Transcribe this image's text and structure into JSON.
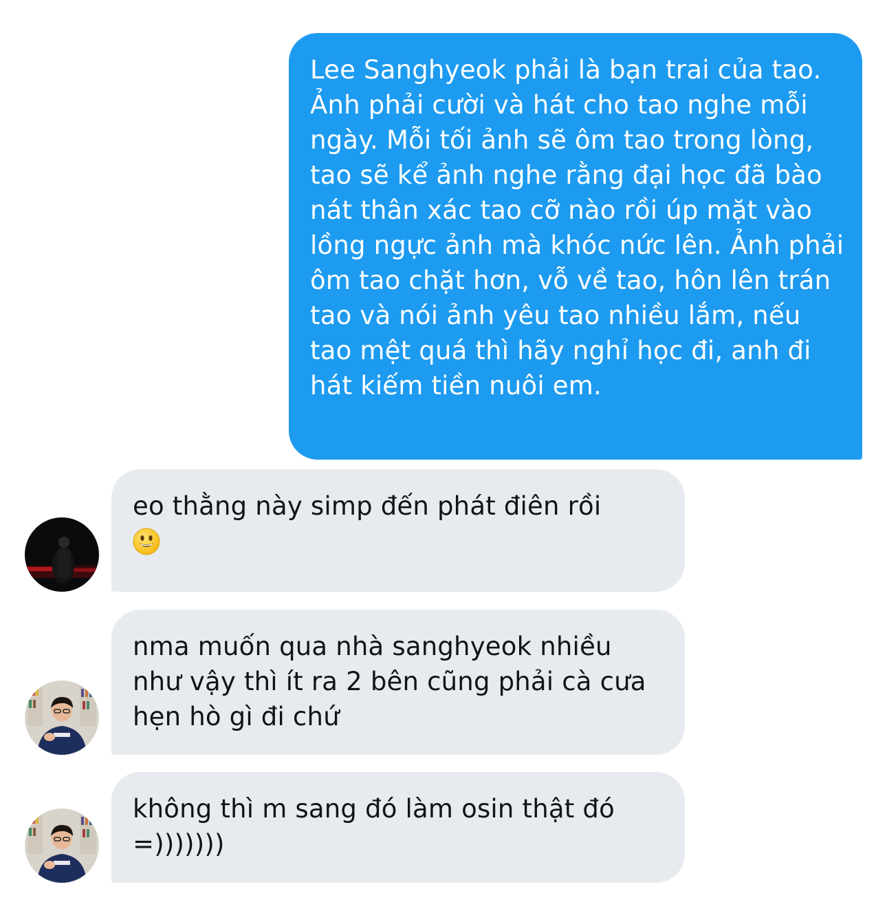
{
  "conversation": {
    "messages": [
      {
        "direction": "sent",
        "text": "Lee Sanghyeok phải là bạn trai của tao. Ảnh phải cười và hát cho tao nghe mỗi ngày. Mỗi tối ảnh sẽ ôm tao trong lòng, tao sẽ kể ảnh nghe rằng đại học đã bào nát thân xác tao cỡ nào rồi úp mặt vào lồng ngực ảnh mà khóc nức lên. Ảnh phải ôm tao chặt hơn, vỗ về tao, hôn lên trán tao và nói ảnh yêu tao nhiều lắm, nếu tao mệt quá thì hãy nghỉ học đi, anh đi hát kiếm tiền nuôi em."
      },
      {
        "direction": "received",
        "text": "eo thằng này simp đến phát điên rồi",
        "emoji": "smiley-face-emoji"
      },
      {
        "direction": "received",
        "text": "nma muốn qua nhà sanghyeok nhiều như vậy thì ít ra 2 bên cũng phải cà cưa hẹn hò gì đi chứ"
      },
      {
        "direction": "received",
        "text": "không thì m sang đó làm osin thật đó =)))))))"
      }
    ]
  },
  "colors": {
    "sent_bubble": "#1d9bf0",
    "received_bubble": "#e7ebef",
    "sent_text": "#ffffff",
    "received_text": "#0f1419"
  }
}
